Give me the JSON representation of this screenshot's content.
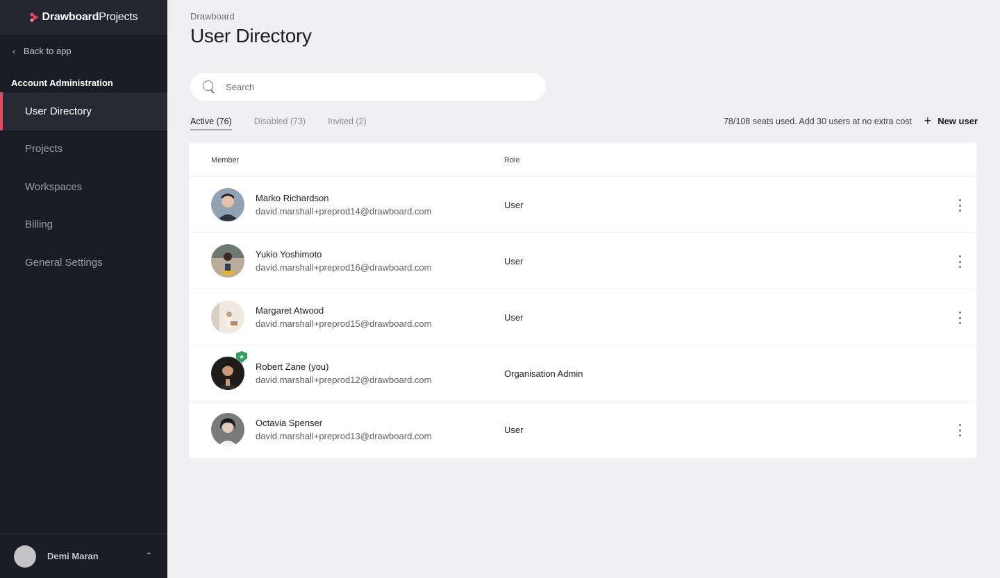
{
  "app": {
    "logo_bold": "Drawboard",
    "logo_light": "Projects",
    "brand_color": "#e7495b"
  },
  "sidebar": {
    "back_label": "Back to app",
    "section_title": "Account Administration",
    "items": [
      {
        "label": "User Directory",
        "active": true
      },
      {
        "label": "Projects"
      },
      {
        "label": "Workspaces"
      },
      {
        "label": "Billing"
      },
      {
        "label": "General Settings"
      }
    ],
    "user": {
      "name": "Demi Maran"
    }
  },
  "header": {
    "breadcrumb": "Drawboard",
    "title": "User Directory"
  },
  "search": {
    "placeholder": "Search",
    "value": ""
  },
  "tabs": [
    {
      "label": "Active (76)",
      "active": true
    },
    {
      "label": "Disabled (73)"
    },
    {
      "label": "Invited (2)"
    }
  ],
  "seats_text": "78/108 seats used. Add 30 users at no extra cost",
  "new_user_label": "New user",
  "table": {
    "headers": {
      "member": "Member",
      "role": "Role"
    },
    "rows": [
      {
        "name": "Marko Richardson",
        "email": "david.marshall+preprod14@drawboard.com",
        "role": "User",
        "avatar_color": "#5d6e80",
        "menu": true
      },
      {
        "name": "Yukio Yoshimoto",
        "email": "david.marshall+preprod16@drawboard.com",
        "role": "User",
        "avatar_color": "#8a7d6a",
        "menu": true
      },
      {
        "name": "Margaret Atwood",
        "email": "david.marshall+preprod15@drawboard.com",
        "role": "User",
        "avatar_color": "#e4ddd2",
        "menu": true
      },
      {
        "name": "Robert Zane (you)",
        "email": "david.marshall+preprod12@drawboard.com",
        "role": "Organisation Admin",
        "avatar_color": "#2a2624",
        "menu": false,
        "admin": true
      },
      {
        "name": "Octavia Spenser",
        "email": "david.marshall+preprod13@drawboard.com",
        "role": "User",
        "avatar_color": "#6b6b6b",
        "menu": true
      }
    ]
  }
}
